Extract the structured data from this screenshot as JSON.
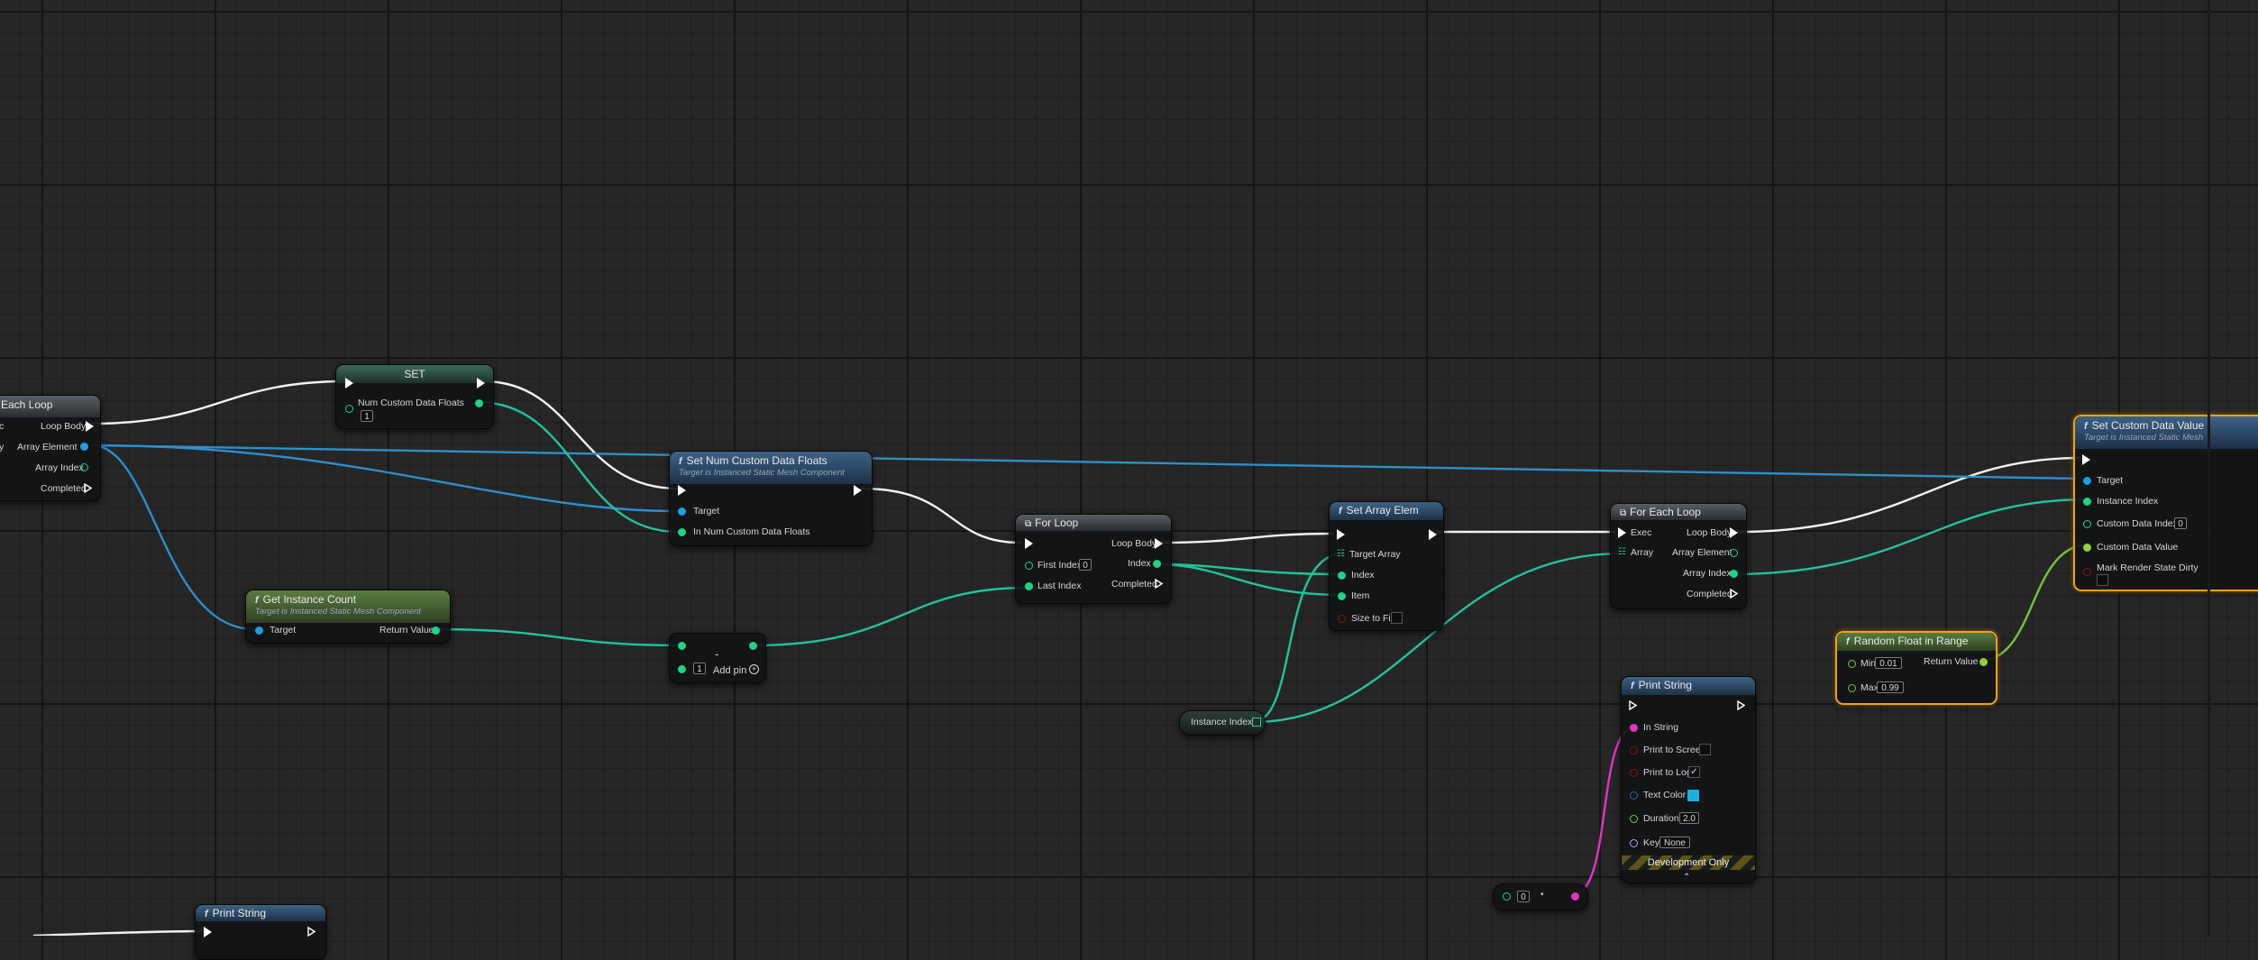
{
  "nodes": {
    "for_each_left": {
      "title": "Each Loop",
      "pins": {
        "exec_in": "c",
        "loop_body": "Loop Body",
        "array": "y",
        "array_element": "Array Element",
        "array_index": "Array Index",
        "completed": "Completed"
      }
    },
    "set_var": {
      "title": "SET",
      "pin_num_custom": "Num Custom Data Floats",
      "value": "1"
    },
    "set_num_custom": {
      "title": "Set Num Custom Data Floats",
      "subtitle": "Target is Instanced Static Mesh Component",
      "pins": {
        "target": "Target",
        "in_num": "In Num Custom Data Floats"
      }
    },
    "get_instance_count": {
      "title": "Get Instance Count",
      "subtitle": "Target is Instanced Static Mesh Component",
      "pins": {
        "target": "Target",
        "return_value": "Return Value"
      }
    },
    "subtract": {
      "symbol": "-",
      "value": "1",
      "add_pin": "Add pin"
    },
    "for_loop": {
      "title": "For Loop",
      "pins": {
        "loop_body": "Loop Body",
        "first_index": "First Index",
        "first_index_value": "0",
        "index": "Index",
        "last_index": "Last Index",
        "completed": "Completed"
      }
    },
    "set_array_elem": {
      "title": "Set Array Elem",
      "pins": {
        "target_array": "Target Array",
        "index": "Index",
        "item": "Item",
        "size_to_fit": "Size to Fit"
      }
    },
    "instance_index_var": {
      "label": "Instance Index"
    },
    "for_each_loop": {
      "title": "For Each Loop",
      "pins": {
        "exec": "Exec",
        "loop_body": "Loop Body",
        "array": "Array",
        "array_element": "Array Element",
        "array_index": "Array Index",
        "completed": "Completed"
      }
    },
    "print_string_main": {
      "title": "Print String",
      "pins": {
        "in_string": "In String",
        "print_to_screen": "Print to Screen",
        "print_to_log": "Print to Log",
        "text_color": "Text Color",
        "duration": "Duration",
        "duration_value": "2.0",
        "key": "Key",
        "key_value": "None"
      },
      "print_to_log_checked": "✓",
      "text_color_hex": "#14b4e6",
      "footer": "Development Only"
    },
    "int_to_string": {
      "value": "0"
    },
    "random_float": {
      "title": "Random Float in Range",
      "pins": {
        "min": "Min",
        "min_value": "0.01",
        "max": "Max",
        "max_value": "0.99",
        "return_value": "Return Value"
      }
    },
    "set_custom_data": {
      "title": "Set Custom Data Value",
      "subtitle": "Target is Instanced Static Mesh",
      "pins": {
        "target": "Target",
        "instance_index": "Instance Index",
        "custom_data_index": "Custom Data Index",
        "custom_data_index_value": "0",
        "custom_data_value": "Custom Data Value",
        "mark_dirty": "Mark Render State Dirty"
      }
    },
    "print_string_bottom": {
      "title": "Print String"
    }
  },
  "colors": {
    "exec": "#ffffff",
    "object": "#1f9fe3",
    "integer": "#1fd28a",
    "string": "#e632c4",
    "float": "#8dd43a",
    "selection": "#f0a017"
  }
}
